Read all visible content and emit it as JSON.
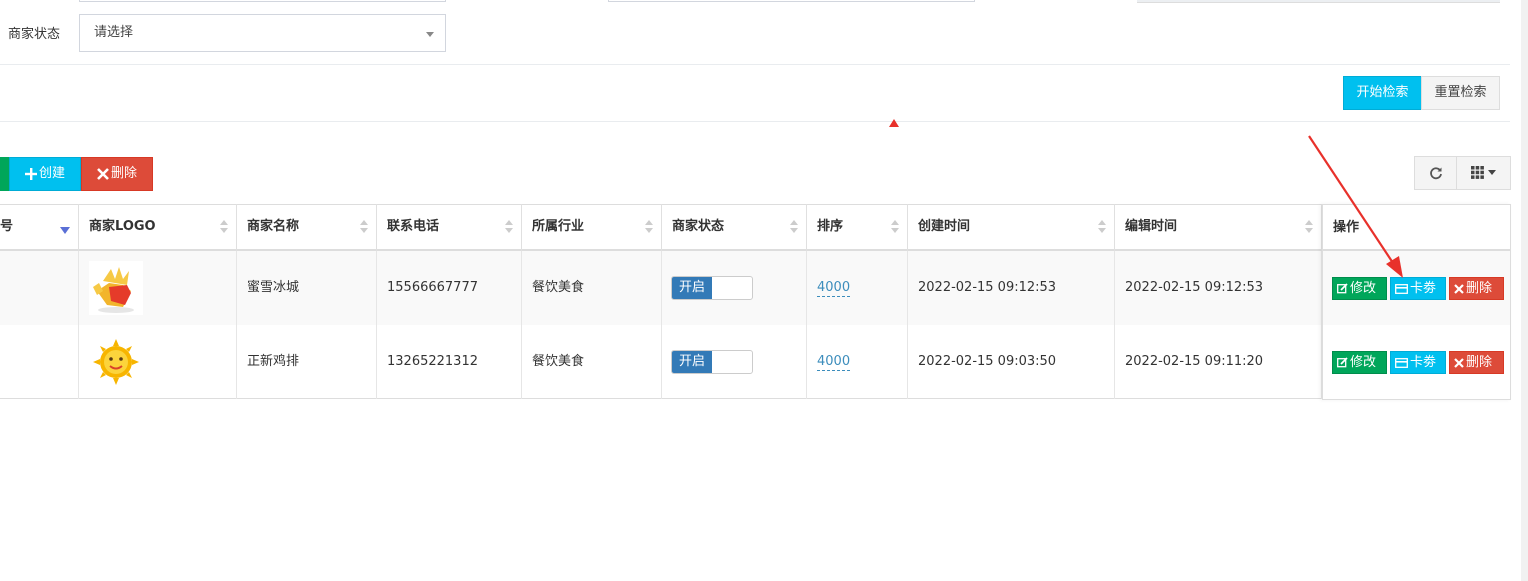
{
  "filter": {
    "status_label": "商家状态",
    "status_select_value": "请选择",
    "search_button": "开始检索",
    "reset_button": "重置检索"
  },
  "toolbar": {
    "create_button": "创建",
    "delete_button": "删除"
  },
  "table": {
    "columns": [
      "号",
      "商家LOGO",
      "商家名称",
      "联系电话",
      "所属行业",
      "商家状态",
      "排序",
      "创建时间",
      "编辑时间",
      "操作"
    ],
    "rows": [
      {
        "name": "蜜雪冰城",
        "phone": "15566667777",
        "industry": "餐饮美食",
        "status": "开启",
        "sort": "4000",
        "created": "2022-02-15 09:12:53",
        "edited": "2022-02-15 09:12:53"
      },
      {
        "name": "正新鸡排",
        "phone": "13265221312",
        "industry": "餐饮美食",
        "status": "开启",
        "sort": "4000",
        "created": "2022-02-15 09:03:50",
        "edited": "2022-02-15 09:11:20"
      }
    ],
    "actions": {
      "edit": "修改",
      "card": "卡劵",
      "delete": "删除"
    }
  },
  "icons": {
    "create": "plus-icon",
    "delete": "times-icon",
    "refresh": "refresh-icon",
    "columns": "grid-icon",
    "edit": "edit-icon",
    "card": "credit-card-icon"
  },
  "colors": {
    "info": "#00c0ef",
    "danger": "#dd4b39",
    "success": "#00a65a",
    "primary": "#337ab7",
    "annotation": "#e8312b"
  }
}
